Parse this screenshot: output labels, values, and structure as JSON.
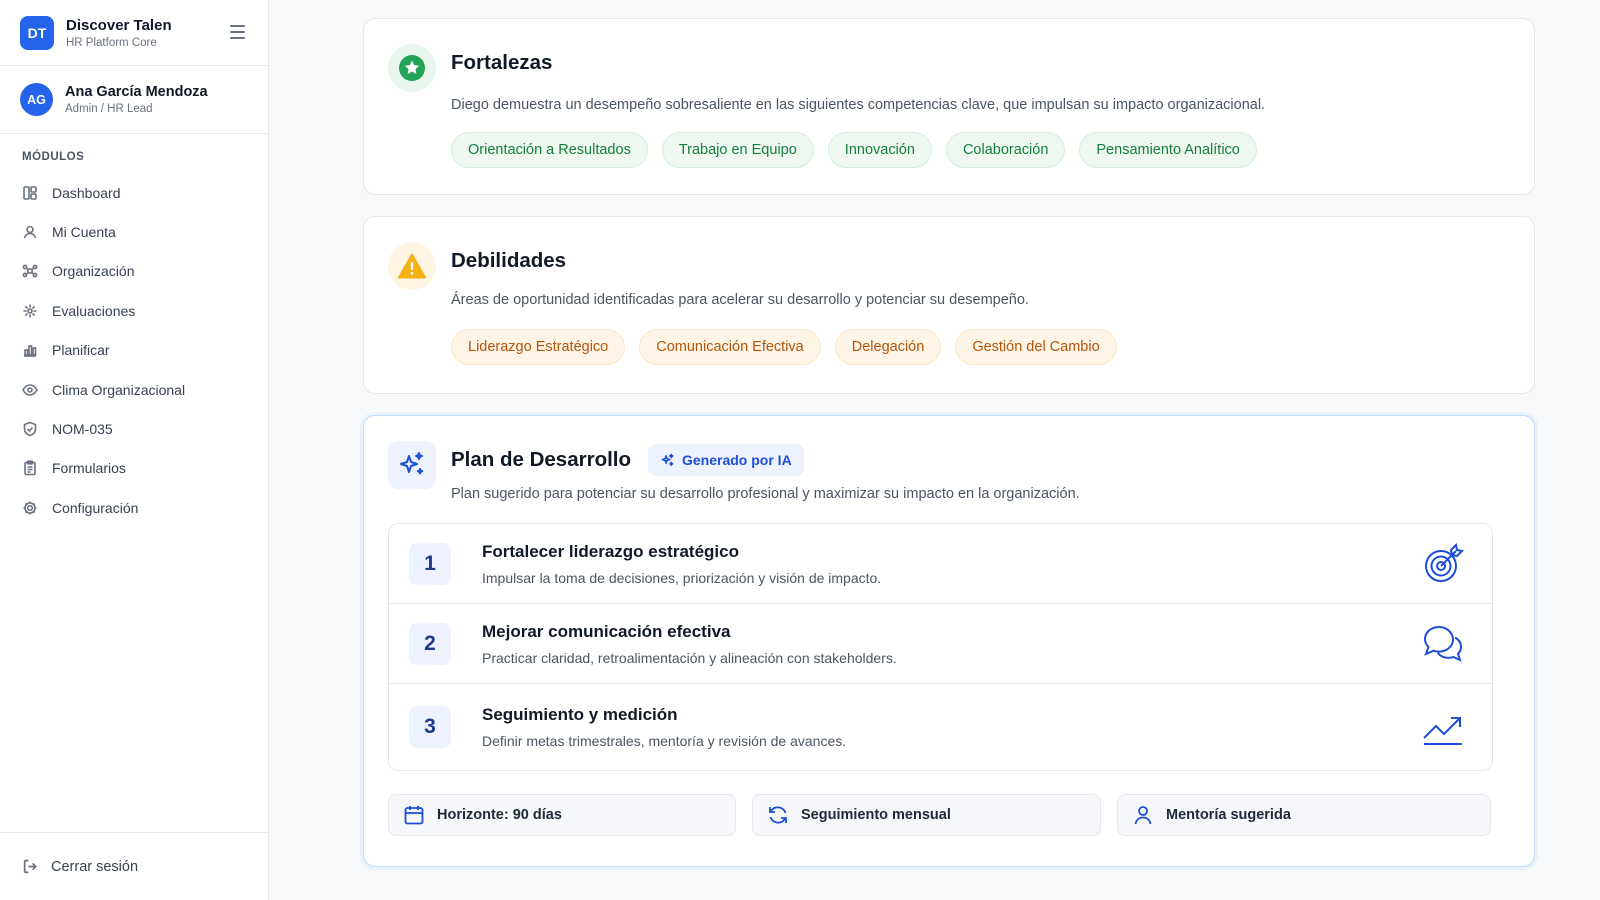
{
  "brand": {
    "initials": "DT",
    "name": "Discover Talen",
    "subtitle": "HR Platform Core"
  },
  "user": {
    "initials": "AG",
    "name": "Ana García Mendoza",
    "role": "Admin / HR Lead"
  },
  "nav": {
    "section_label": "MÓDULOS",
    "items": [
      {
        "label": "Dashboard",
        "icon": "dashboard-icon"
      },
      {
        "label": "Mi Cuenta",
        "icon": "user-icon"
      },
      {
        "label": "Organización",
        "icon": "organization-icon"
      },
      {
        "label": "Evaluaciones",
        "icon": "evaluations-icon"
      },
      {
        "label": "Planificar",
        "icon": "chart-icon"
      },
      {
        "label": "Clima Organizacional",
        "icon": "eye-icon"
      },
      {
        "label": "NOM-035",
        "icon": "shield-icon"
      },
      {
        "label": "Formularios",
        "icon": "clipboard-icon"
      },
      {
        "label": "Configuración",
        "icon": "gear-icon"
      }
    ],
    "logout_label": "Cerrar sesión"
  },
  "strengths": {
    "title": "Fortalezas",
    "description": "Diego demuestra un desempeño sobresaliente en las siguientes competencias clave, que impulsan su impacto organizacional.",
    "chips": [
      "Orientación a Resultados",
      "Trabajo en Equipo",
      "Innovación",
      "Colaboración",
      "Pensamiento Analítico"
    ]
  },
  "weaknesses": {
    "title": "Debilidades",
    "description": "Áreas de oportunidad identificadas para acelerar su desarrollo y potenciar su desempeño.",
    "chips": [
      "Liderazgo Estratégico",
      "Comunicación Efectiva",
      "Delegación",
      "Gestión del Cambio"
    ]
  },
  "plan": {
    "title": "Plan de Desarrollo",
    "badge": "Generado por IA",
    "description": "Plan sugerido para potenciar su desarrollo profesional y maximizar su impacto en la organización.",
    "steps": [
      {
        "number": "1",
        "title": "Fortalecer liderazgo estratégico",
        "subtitle": "Impulsar la toma de decisiones, priorización y visión de impacto.",
        "icon": "target-icon"
      },
      {
        "number": "2",
        "title": "Mejorar comunicación efectiva",
        "subtitle": "Practicar claridad, retroalimentación y alineación con stakeholders.",
        "icon": "chat-bubbles-icon"
      },
      {
        "number": "3",
        "title": "Seguimiento y medición",
        "subtitle": "Definir metas trimestrales, mentoría y revisión de avances.",
        "icon": "trending-up-icon"
      }
    ],
    "footer": [
      {
        "label": "Horizonte: 90 días",
        "icon": "calendar-icon"
      },
      {
        "label": "Seguimiento mensual",
        "icon": "refresh-icon"
      },
      {
        "label": "Mentoría sugerida",
        "icon": "user-icon"
      }
    ]
  },
  "colors": {
    "accent": "#2563eb",
    "strength_green": "#15803d",
    "weakness_orange": "#b45309",
    "warning_yellow": "#f59e0b"
  }
}
